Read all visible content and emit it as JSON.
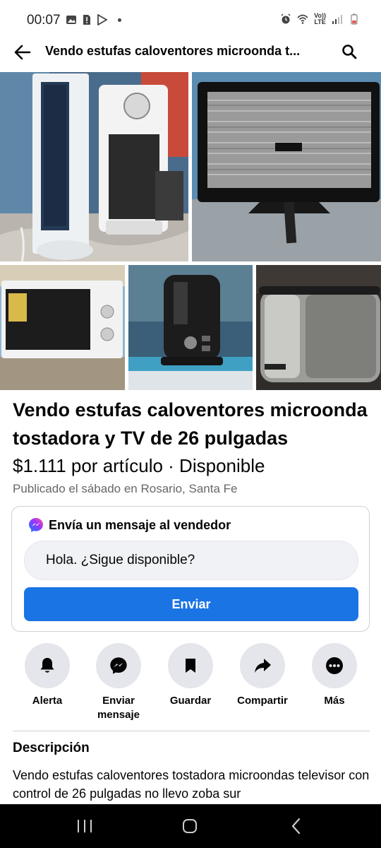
{
  "status_bar": {
    "time": "00:07",
    "network_line1": "Vo))",
    "network_line2": "LTE"
  },
  "header": {
    "title": "Vendo estufas caloventores microonda t...",
    "back_icon": "arrow-left-icon",
    "search_icon": "search-icon"
  },
  "photos": [
    {
      "subject": "heaters"
    },
    {
      "subject": "tv"
    },
    {
      "subject": "microwave"
    },
    {
      "subject": "toaster-black"
    },
    {
      "subject": "toaster-steel"
    }
  ],
  "listing": {
    "title": "Vendo estufas caloventores microonda tostadora y TV de 26 pulgadas",
    "price_line": "$1.111 por artículo · Disponible",
    "published": "Publicado el sábado en Rosario, Santa Fe"
  },
  "message_card": {
    "title": "Envía un mensaje al vendedor",
    "input_value": "Hola. ¿Sigue disponible?",
    "send_label": "Enviar",
    "accent": "#1b74e4"
  },
  "actions": [
    {
      "icon": "bell-icon",
      "label": "Alerta"
    },
    {
      "icon": "messenger-icon",
      "label": "Enviar mensaje"
    },
    {
      "icon": "bookmark-icon",
      "label": "Guardar"
    },
    {
      "icon": "share-icon",
      "label": "Compartir"
    },
    {
      "icon": "more-icon",
      "label": "Más"
    }
  ],
  "description": {
    "heading": "Descripción",
    "text": "Vendo estufas caloventores tostadora microondas televisor con control de 26 pulgadas no llevo zoba sur"
  }
}
